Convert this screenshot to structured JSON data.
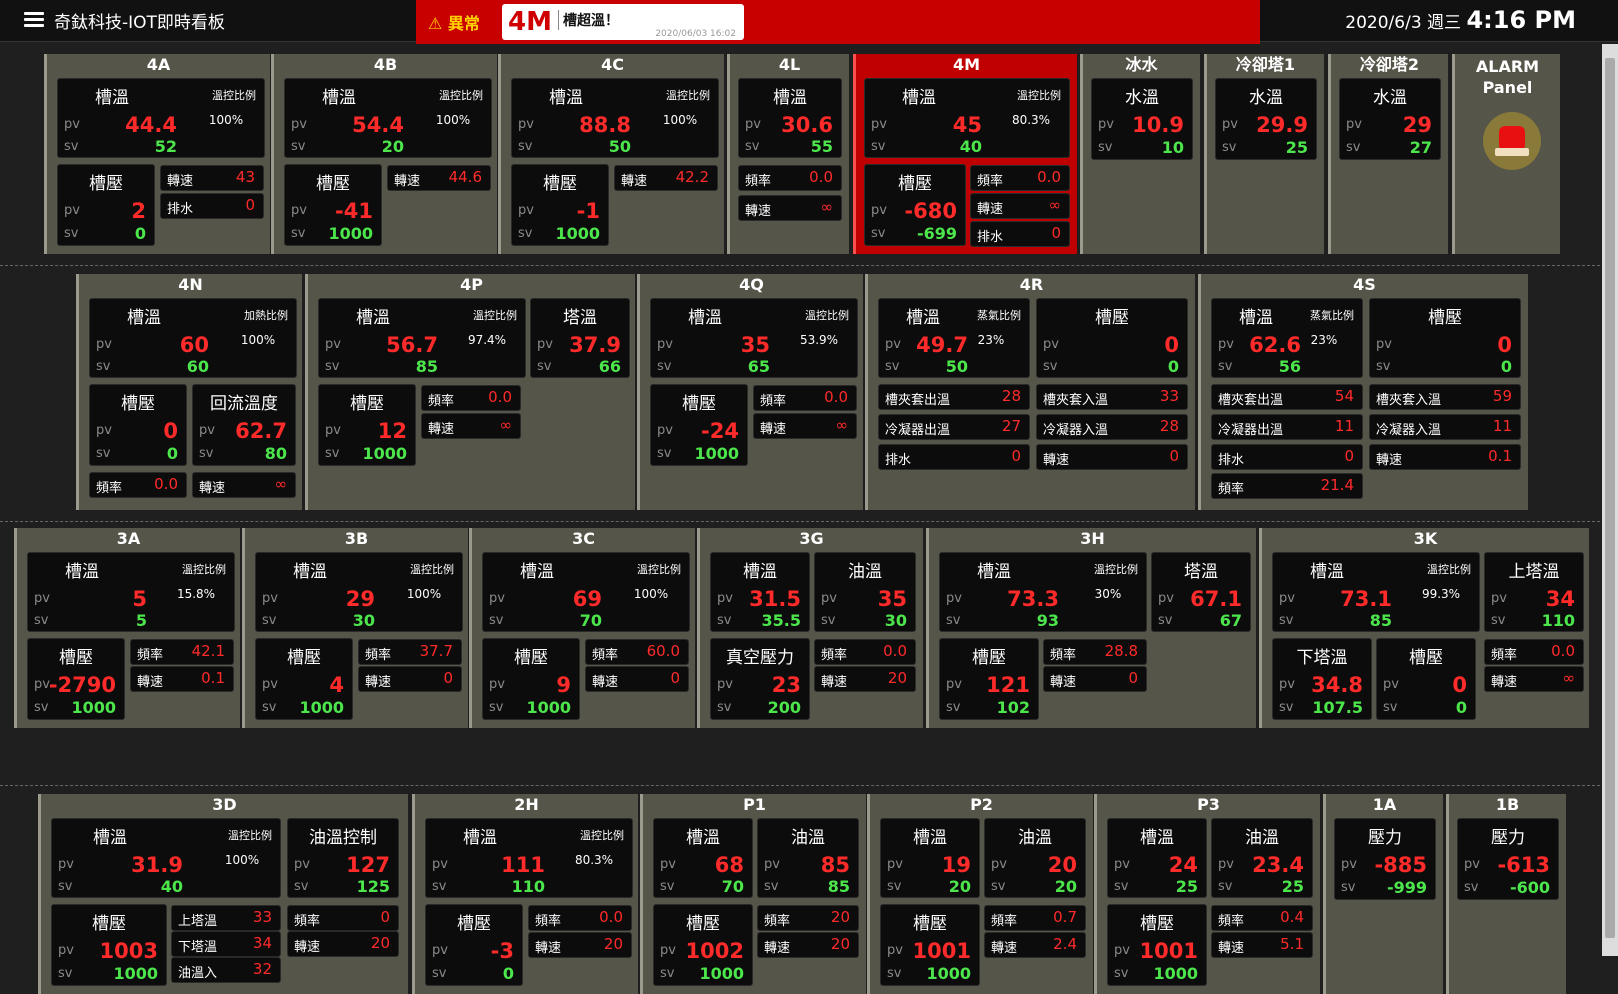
{
  "header": {
    "title": "奇鈦科技-IOT即時看板",
    "alarm_status": "⚠ 異常",
    "alarm_unit": "4M",
    "alarm_message": "槽超溫！",
    "alarm_time": "2020/06/03 16:02",
    "date": "2020/6/3 週三",
    "time": "4:16 PM"
  },
  "alarm_panel": {
    "label_line1": "ALARM",
    "label_line2": "Panel"
  },
  "units": {
    "4A": {
      "title": "4A",
      "temp": {
        "label": "槽溫",
        "ratio_label": "溫控比例",
        "ratio": "100%",
        "pv": "44.4",
        "sv": "52"
      },
      "press": {
        "label": "槽壓",
        "pv": "2",
        "sv": "0"
      },
      "cells": [
        {
          "label": "轉速",
          "value": "43"
        },
        {
          "label": "排水",
          "value": "0"
        }
      ]
    },
    "4B": {
      "title": "4B",
      "temp": {
        "label": "槽溫",
        "ratio_label": "溫控比例",
        "ratio": "100%",
        "pv": "54.4",
        "sv": "20"
      },
      "press": {
        "label": "槽壓",
        "pv": "-41",
        "sv": "1000"
      },
      "cells": [
        {
          "label": "轉速",
          "value": "44.6"
        }
      ]
    },
    "4C": {
      "title": "4C",
      "temp": {
        "label": "槽溫",
        "ratio_label": "溫控比例",
        "ratio": "100%",
        "pv": "88.8",
        "sv": "50"
      },
      "press": {
        "label": "槽壓",
        "pv": "-1",
        "sv": "1000"
      },
      "cells": [
        {
          "label": "轉速",
          "value": "42.2"
        }
      ]
    },
    "4L": {
      "title": "4L",
      "temp": {
        "label": "槽溫",
        "pv": "30.6",
        "sv": "55"
      },
      "cells": [
        {
          "label": "頻率",
          "value": "0.0"
        },
        {
          "label": "轉速",
          "value": "∞"
        }
      ]
    },
    "4M": {
      "title": "4M",
      "temp": {
        "label": "槽溫",
        "ratio_label": "溫控比例",
        "ratio": "80.3%",
        "pv": "45",
        "sv": "40"
      },
      "press": {
        "label": "槽壓",
        "pv": "-680",
        "sv": "-699"
      },
      "cells": [
        {
          "label": "頻率",
          "value": "0.0"
        },
        {
          "label": "轉速",
          "value": "∞"
        },
        {
          "label": "排水",
          "value": "0"
        }
      ]
    },
    "ice": {
      "title": "冰水",
      "temp": {
        "label": "水溫",
        "pv": "10.9",
        "sv": "10"
      }
    },
    "ct1": {
      "title": "冷卻塔1",
      "temp": {
        "label": "水溫",
        "pv": "29.9",
        "sv": "25"
      }
    },
    "ct2": {
      "title": "冷卻塔2",
      "temp": {
        "label": "水溫",
        "pv": "29",
        "sv": "27"
      }
    },
    "4N": {
      "title": "4N",
      "temp": {
        "label": "槽溫",
        "ratio_label": "加熱比例",
        "ratio": "100%",
        "pv": "60",
        "sv": "60"
      },
      "press": {
        "label": "槽壓",
        "pv": "0",
        "sv": "0"
      },
      "extra": {
        "label": "回流溫度",
        "pv": "62.7",
        "sv": "80"
      },
      "cells": [
        {
          "label": "頻率",
          "value": "0.0"
        },
        {
          "label": "轉速",
          "value": "∞"
        }
      ]
    },
    "4P": {
      "title": "4P",
      "temp": {
        "label": "槽溫",
        "ratio_label": "溫控比例",
        "ratio": "97.4%",
        "pv": "56.7",
        "sv": "85"
      },
      "extra": {
        "label": "塔溫",
        "pv": "37.9",
        "sv": "66"
      },
      "press": {
        "label": "槽壓",
        "pv": "12",
        "sv": "1000"
      },
      "cells": [
        {
          "label": "頻率",
          "value": "0.0"
        },
        {
          "label": "轉速",
          "value": "∞"
        }
      ]
    },
    "4Q": {
      "title": "4Q",
      "temp": {
        "label": "槽溫",
        "ratio_label": "溫控比例",
        "ratio": "53.9%",
        "pv": "35",
        "sv": "65"
      },
      "press": {
        "label": "槽壓",
        "pv": "-24",
        "sv": "1000"
      },
      "cells": [
        {
          "label": "頻率",
          "value": "0.0"
        },
        {
          "label": "轉速",
          "value": "∞"
        }
      ]
    },
    "4R": {
      "title": "4R",
      "temp": {
        "label": "槽溫",
        "ratio_label": "蒸氣比例",
        "ratio": "23%",
        "pv": "49.7",
        "sv": "50"
      },
      "press": {
        "label": "槽壓",
        "pv": "0",
        "sv": "0"
      },
      "cells": [
        {
          "label": "槽夾套出溫",
          "value": "28"
        },
        {
          "label": "槽夾套入溫",
          "value": "33"
        },
        {
          "label": "冷凝器出溫",
          "value": "27"
        },
        {
          "label": "冷凝器入溫",
          "value": "28"
        },
        {
          "label": "排水",
          "value": "0"
        },
        {
          "label": "轉速",
          "value": "0"
        }
      ]
    },
    "4S": {
      "title": "4S",
      "temp": {
        "label": "槽溫",
        "ratio_label": "蒸氣比例",
        "ratio": "23%",
        "pv": "62.6",
        "sv": "56"
      },
      "press": {
        "label": "槽壓",
        "pv": "0",
        "sv": "0"
      },
      "cells": [
        {
          "label": "槽夾套出溫",
          "value": "54"
        },
        {
          "label": "槽夾套入溫",
          "value": "59"
        },
        {
          "label": "冷凝器出溫",
          "value": "11"
        },
        {
          "label": "冷凝器入溫",
          "value": "11"
        },
        {
          "label": "排水",
          "value": "0"
        },
        {
          "label": "轉速",
          "value": "0.1"
        },
        {
          "label": "頻率",
          "value": "21.4"
        }
      ]
    },
    "3A": {
      "title": "3A",
      "temp": {
        "label": "槽溫",
        "ratio_label": "溫控比例",
        "ratio": "15.8%",
        "pv": "5",
        "sv": "5"
      },
      "press": {
        "label": "槽壓",
        "pv": "-2790",
        "sv": "1000"
      },
      "cells": [
        {
          "label": "頻率",
          "value": "42.1"
        },
        {
          "label": "轉速",
          "value": "0.1"
        }
      ]
    },
    "3B": {
      "title": "3B",
      "temp": {
        "label": "槽溫",
        "ratio_label": "溫控比例",
        "ratio": "100%",
        "pv": "29",
        "sv": "30"
      },
      "press": {
        "label": "槽壓",
        "pv": "4",
        "sv": "1000"
      },
      "cells": [
        {
          "label": "頻率",
          "value": "37.7"
        },
        {
          "label": "轉速",
          "value": "0"
        }
      ]
    },
    "3C": {
      "title": "3C",
      "temp": {
        "label": "槽溫",
        "ratio_label": "溫控比例",
        "ratio": "100%",
        "pv": "69",
        "sv": "70"
      },
      "press": {
        "label": "槽壓",
        "pv": "9",
        "sv": "1000"
      },
      "cells": [
        {
          "label": "頻率",
          "value": "60.0"
        },
        {
          "label": "轉速",
          "value": "0"
        }
      ]
    },
    "3G": {
      "title": "3G",
      "temp": {
        "label": "槽溫",
        "pv": "31.5",
        "sv": "35.5"
      },
      "extra": {
        "label": "油溫",
        "pv": "35",
        "sv": "30"
      },
      "press": {
        "label": "真空壓力",
        "pv": "23",
        "sv": "200"
      },
      "cells": [
        {
          "label": "頻率",
          "value": "0.0"
        },
        {
          "label": "轉速",
          "value": "20"
        }
      ]
    },
    "3H": {
      "title": "3H",
      "temp": {
        "label": "槽溫",
        "ratio_label": "溫控比例",
        "ratio": "30%",
        "pv": "73.3",
        "sv": "93"
      },
      "extra": {
        "label": "塔溫",
        "pv": "67.1",
        "sv": "67"
      },
      "press": {
        "label": "槽壓",
        "pv": "121",
        "sv": "102"
      },
      "cells": [
        {
          "label": "頻率",
          "value": "28.8"
        },
        {
          "label": "轉速",
          "value": "0"
        }
      ]
    },
    "3K": {
      "title": "3K",
      "temp": {
        "label": "槽溫",
        "ratio_label": "溫控比例",
        "ratio": "99.3%",
        "pv": "73.1",
        "sv": "85"
      },
      "extra": {
        "label": "上塔溫",
        "pv": "34",
        "sv": "110"
      },
      "press": {
        "label": "下塔溫",
        "pv": "34.8",
        "sv": "107.5"
      },
      "press2": {
        "label": "槽壓",
        "pv": "0",
        "sv": "0"
      },
      "cells": [
        {
          "label": "頻率",
          "value": "0.0"
        },
        {
          "label": "轉速",
          "value": "∞"
        }
      ]
    },
    "3D": {
      "title": "3D",
      "temp": {
        "label": "槽溫",
        "ratio_label": "溫控比例",
        "ratio": "100%",
        "pv": "31.9",
        "sv": "40"
      },
      "extra": {
        "label": "油溫控制",
        "pv": "127",
        "sv": "125"
      },
      "press": {
        "label": "槽壓",
        "pv": "1003",
        "sv": "1000"
      },
      "cells": [
        {
          "label": "上塔溫",
          "value": "33"
        },
        {
          "label": "下塔溫",
          "value": "34"
        },
        {
          "label": "油溫入",
          "value": "32"
        },
        {
          "label": "頻率",
          "value": "0"
        },
        {
          "label": "轉速",
          "value": "20"
        }
      ]
    },
    "2H": {
      "title": "2H",
      "temp": {
        "label": "槽溫",
        "ratio_label": "溫控比例",
        "ratio": "80.3%",
        "pv": "111",
        "sv": "110"
      },
      "press": {
        "label": "槽壓",
        "pv": "-3",
        "sv": "0"
      },
      "cells": [
        {
          "label": "頻率",
          "value": "0.0"
        },
        {
          "label": "轉速",
          "value": "20"
        }
      ]
    },
    "P1": {
      "title": "P1",
      "temp": {
        "label": "槽溫",
        "pv": "68",
        "sv": "70"
      },
      "extra": {
        "label": "油溫",
        "pv": "85",
        "sv": "85"
      },
      "press": {
        "label": "槽壓",
        "pv": "1002",
        "sv": "1000"
      },
      "cells": [
        {
          "label": "頻率",
          "value": "20"
        },
        {
          "label": "轉速",
          "value": "20"
        }
      ]
    },
    "P2": {
      "title": "P2",
      "temp": {
        "label": "槽溫",
        "pv": "19",
        "sv": "20"
      },
      "extra": {
        "label": "油溫",
        "pv": "20",
        "sv": "20"
      },
      "press": {
        "label": "槽壓",
        "pv": "1001",
        "sv": "1000"
      },
      "cells": [
        {
          "label": "頻率",
          "value": "0.7"
        },
        {
          "label": "轉速",
          "value": "2.4"
        }
      ]
    },
    "P3": {
      "title": "P3",
      "temp": {
        "label": "槽溫",
        "pv": "24",
        "sv": "25"
      },
      "extra": {
        "label": "油溫",
        "pv": "23.4",
        "sv": "25"
      },
      "press": {
        "label": "槽壓",
        "pv": "1001",
        "sv": "1000"
      },
      "cells": [
        {
          "label": "頻率",
          "value": "0.4"
        },
        {
          "label": "轉速",
          "value": "5.1"
        }
      ]
    },
    "1A": {
      "title": "1A",
      "temp": {
        "label": "壓力",
        "pv": "-885",
        "sv": "-999"
      }
    },
    "1B": {
      "title": "1B",
      "temp": {
        "label": "壓力",
        "pv": "-613",
        "sv": "-600"
      }
    }
  },
  "labels": {
    "pv": "pv",
    "sv": "sv"
  }
}
